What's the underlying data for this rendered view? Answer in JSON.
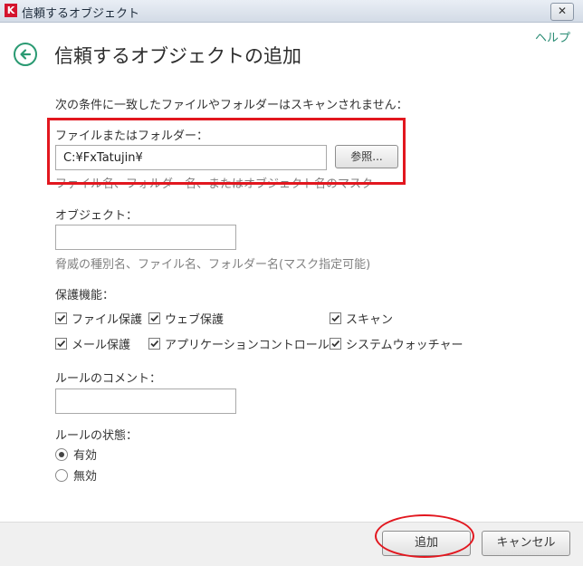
{
  "window": {
    "title": "信頼するオブジェクト",
    "close_label": "✕",
    "help_link": "ヘルプ"
  },
  "header": {
    "title": "信頼するオブジェクトの追加"
  },
  "intro_text": "次の条件に一致したファイルやフォルダーはスキャンされません：",
  "file_section": {
    "label": "ファイルまたはフォルダー：",
    "value": "C:¥FxTatujin¥",
    "browse_label": "参照...",
    "hint": "ファイル名、フォルダー名、またはオブジェクト名のマスク"
  },
  "object_section": {
    "label": "オブジェクト：",
    "value": "",
    "hint": "脅威の種別名、ファイル名、フォルダー名(マスク指定可能)"
  },
  "protection": {
    "label": "保護機能：",
    "items": [
      {
        "label": "ファイル保護",
        "checked": true
      },
      {
        "label": "ウェブ保護",
        "checked": true
      },
      {
        "label": "スキャン",
        "checked": true
      },
      {
        "label": "メール保護",
        "checked": true
      },
      {
        "label": "アプリケーションコントロール",
        "checked": true
      },
      {
        "label": "システムウォッチャー",
        "checked": true
      }
    ]
  },
  "comment_section": {
    "label": "ルールのコメント：",
    "value": ""
  },
  "status_section": {
    "label": "ルールの状態：",
    "options": [
      {
        "label": "有効",
        "selected": true
      },
      {
        "label": "無効",
        "selected": false
      }
    ]
  },
  "footer": {
    "add_label": "追加",
    "cancel_label": "キャンセル"
  },
  "colors": {
    "accent": "#2a9a72",
    "highlight": "#e2171f"
  }
}
